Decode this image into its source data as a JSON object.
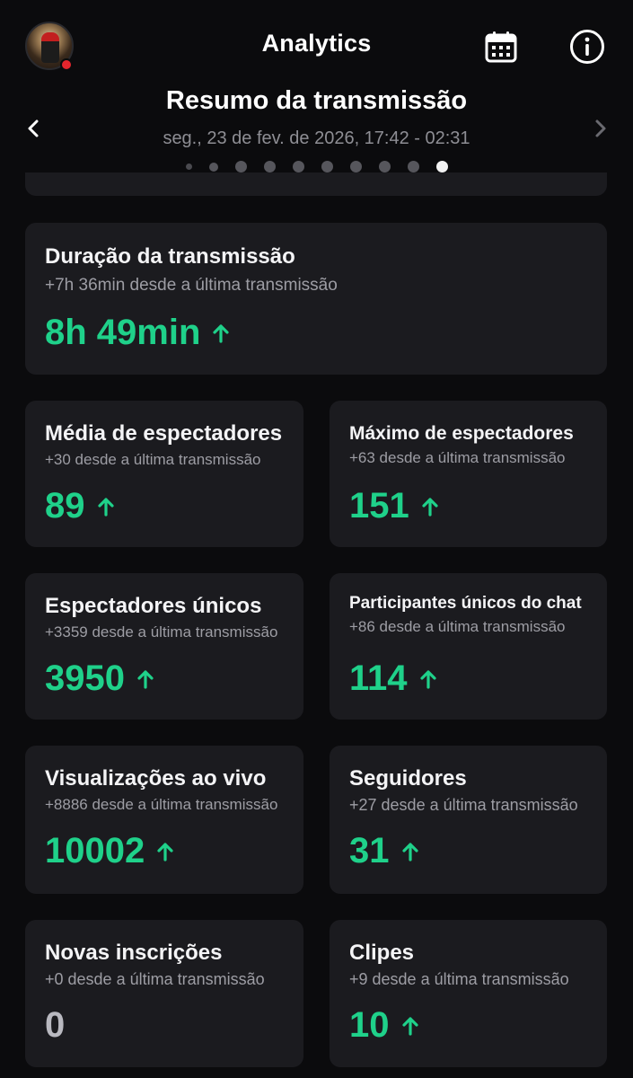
{
  "header": {
    "title": "Analytics",
    "avatar_icon": "user-avatar",
    "calendar_icon": "calendar-icon",
    "info_icon": "info-icon",
    "live_dot_color": "#e5252d"
  },
  "summary": {
    "title": "Resumo da transmissão",
    "date_range": "seg., 23 de fev. de 2026, 17:42 - 02:31",
    "page_count": 10,
    "active_page": 10
  },
  "colors": {
    "accent_green": "#1fd18a",
    "card_bg": "#1b1b1f",
    "bg": "#0b0b0d"
  },
  "stats": {
    "duration": {
      "title": "Duração da transmissão",
      "subtitle": "+7h 36min desde a última transmissão",
      "value": "8h 49min",
      "trend": "up"
    },
    "avg_viewers": {
      "title": "Média de espectadores",
      "subtitle": "+30 desde a última transmissão",
      "value": "89",
      "trend": "up"
    },
    "max_viewers": {
      "title": "Máximo de espectadores",
      "subtitle": "+63 desde a última transmissão",
      "value": "151",
      "trend": "up"
    },
    "unique_viewers": {
      "title": "Espectadores únicos",
      "subtitle": "+3359 desde a última transmissão",
      "value": "3950",
      "trend": "up"
    },
    "unique_chatters": {
      "title": "Participantes únicos do chat",
      "subtitle": "+86 desde a última transmissão",
      "value": "114",
      "trend": "up"
    },
    "live_views": {
      "title": "Visualizações ao vivo",
      "subtitle": "+8886 desde a última transmissão",
      "value": "10002",
      "trend": "up"
    },
    "followers": {
      "title": "Seguidores",
      "subtitle": "+27 desde a última transmissão",
      "value": "31",
      "trend": "up"
    },
    "new_subs": {
      "title": "Novas inscrições",
      "subtitle": "+0 desde a última transmissão",
      "value": "0",
      "trend": "none"
    },
    "clips": {
      "title": "Clipes",
      "subtitle": "+9 desde a última transmissão",
      "value": "10",
      "trend": "up"
    }
  }
}
